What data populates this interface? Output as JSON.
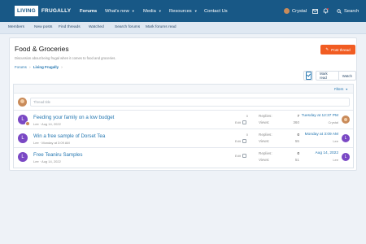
{
  "header": {
    "logo_box": "LIVING",
    "logo_text": "FRUGALLY",
    "nav": [
      {
        "label": "Forums"
      },
      {
        "label": "What's new"
      },
      {
        "label": "Media"
      },
      {
        "label": "Resources"
      },
      {
        "label": "Contact Us"
      }
    ],
    "user": "Crystal",
    "search_label": "Search"
  },
  "subnav": [
    "Members",
    "New posts",
    "Find threads",
    "Watched",
    "Search forums",
    "Mark forums read"
  ],
  "forum": {
    "title": "Food & Groceries",
    "description": "Discussion about being frugal when it comes to food and groceries.",
    "breadcrumb": [
      "Forums",
      "Living Frugally"
    ],
    "post_thread": "Post thread",
    "mark_read": "Mark read",
    "watch": "Watch",
    "filters": "Filters",
    "thread_placeholder": "Thread title"
  },
  "threads": [
    {
      "initial": "L",
      "title": "Feeding your family on a low budget",
      "author": "Lee",
      "date": "Aug 14, 2022",
      "count": "0",
      "edit": "Edit",
      "replies_label": "Replies:",
      "replies": "7",
      "views_label": "Views:",
      "views": "360",
      "latest_date": "Tuesday at 12:37 PM",
      "latest_user": "Crystal"
    },
    {
      "initial": "L",
      "title": "Win a free sample of Dorset Tea",
      "author": "Lee",
      "date": "Monday at 3:09 AM",
      "count": "0",
      "edit": "Edit",
      "replies_label": "Replies:",
      "replies": "0",
      "views_label": "Views:",
      "views": "55",
      "latest_date": "Monday at 3:09 AM",
      "latest_user": "Lee"
    },
    {
      "initial": "L",
      "title": "Free Teaniru Samples",
      "author": "Lee",
      "date": "Aug 14, 2022",
      "count": "",
      "edit": "Edit",
      "replies_label": "Replies:",
      "replies": "0",
      "views_label": "Views:",
      "views": "51",
      "latest_date": "Aug 14, 2022",
      "latest_user": "Lee"
    }
  ],
  "icons": {
    "bell": "bell-icon",
    "envelope": "envelope-icon",
    "search": "search-icon"
  }
}
